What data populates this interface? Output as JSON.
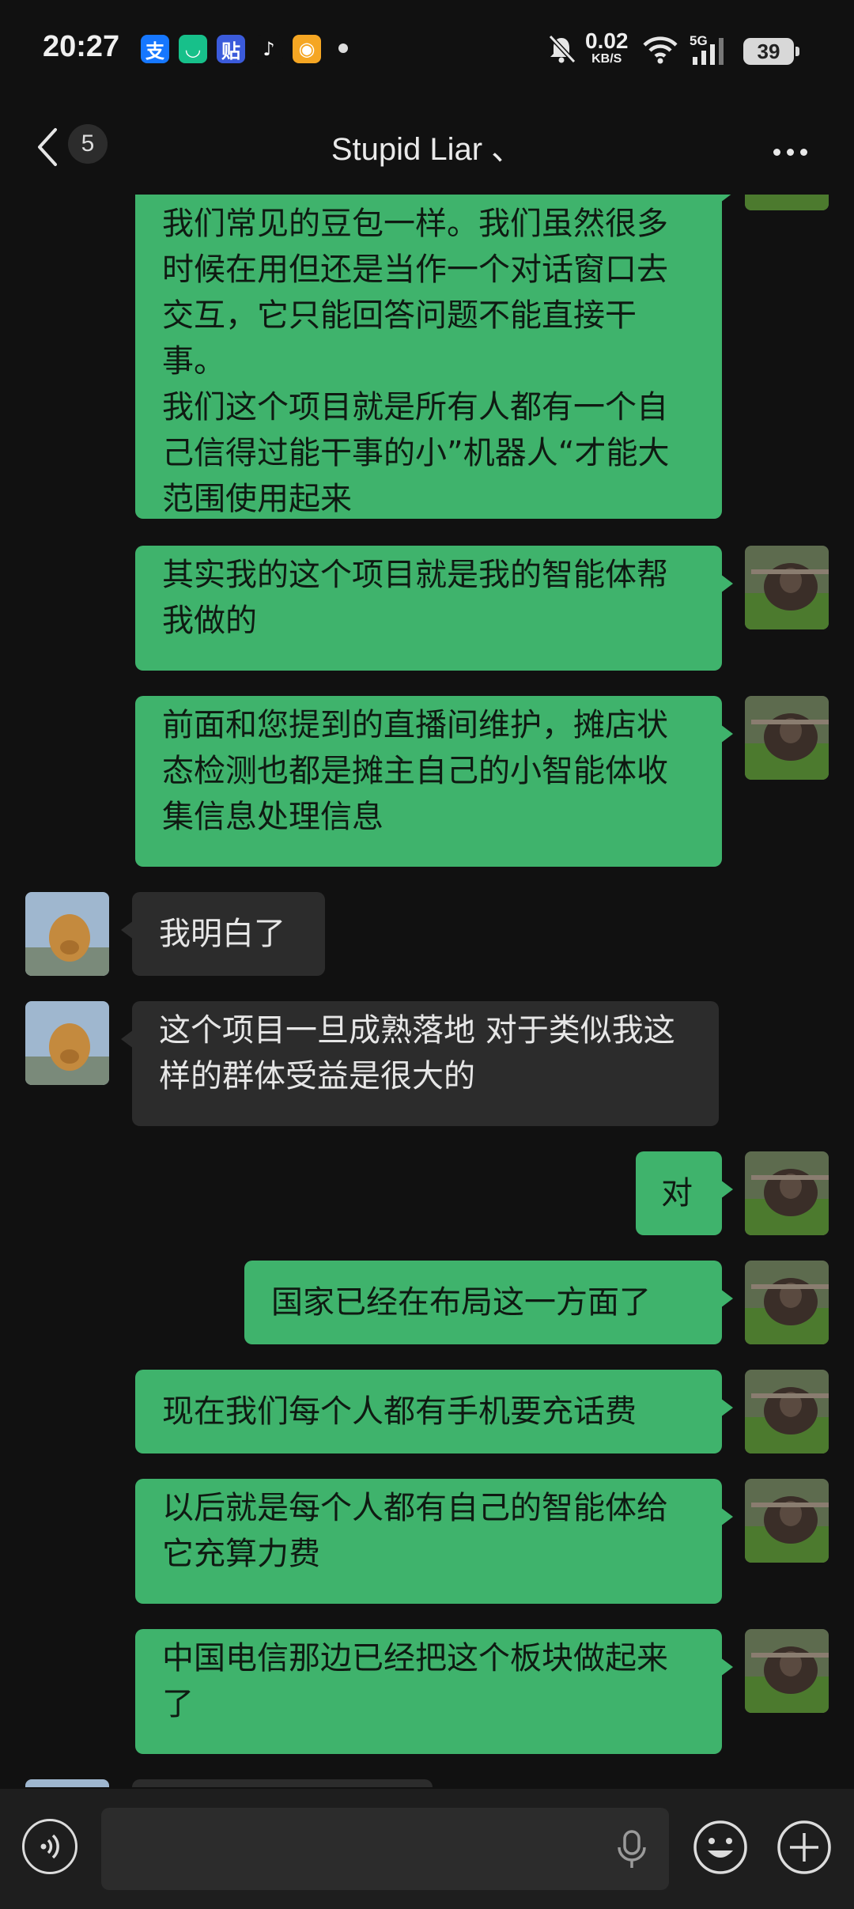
{
  "status": {
    "time": "20:27",
    "net_speed": "0.02",
    "net_unit": "KB/S",
    "net_type": "5G",
    "battery": "39",
    "app_icons": [
      {
        "name": "alipay-icon",
        "glyph": "支",
        "color": "#1677ff"
      },
      {
        "name": "meituan-icon",
        "glyph": "◡",
        "color": "#17c08a"
      },
      {
        "name": "tieba-icon",
        "glyph": "贴",
        "color": "#3b5bdb"
      },
      {
        "name": "tiktok-icon",
        "glyph": "♪",
        "color": "#111111"
      },
      {
        "name": "weibo-icon",
        "glyph": "◉",
        "color": "#f5a623"
      }
    ]
  },
  "nav": {
    "unread_count": "5",
    "title": "Stupid Liar 、"
  },
  "messages": [
    {
      "sender": "me",
      "text": "我们常见的豆包一样。我们虽然很多时候在用但还是当作一个对话窗口去交互，它只能回答问题不能直接干事。\n我们这个项目就是所有人都有一个自己信得过能干事的小”机器人“才能大范围使用起来"
    },
    {
      "sender": "me",
      "text": "其实我的这个项目就是我的智能体帮我做的"
    },
    {
      "sender": "me",
      "text": "前面和您提到的直播间维护，摊店状态检测也都是摊主自己的小智能体收集信息处理信息"
    },
    {
      "sender": "them",
      "text": "我明白了"
    },
    {
      "sender": "them",
      "text": "这个项目一旦成熟落地 对于类似我这样的群体受益是很大的"
    },
    {
      "sender": "me",
      "text": "对"
    },
    {
      "sender": "me",
      "text": "国家已经在布局这一方面了"
    },
    {
      "sender": "me",
      "text": "现在我们每个人都有手机要充话费"
    },
    {
      "sender": "me",
      "text": "以后就是每个人都有自己的智能体给它充算力费"
    },
    {
      "sender": "me",
      "text": "中国电信那边已经把这个板块做起来了"
    }
  ],
  "input": {
    "placeholder": ""
  },
  "colors": {
    "my_bubble": "#3fb36c",
    "their_bubble": "#2c2c2c",
    "background": "#111111"
  }
}
